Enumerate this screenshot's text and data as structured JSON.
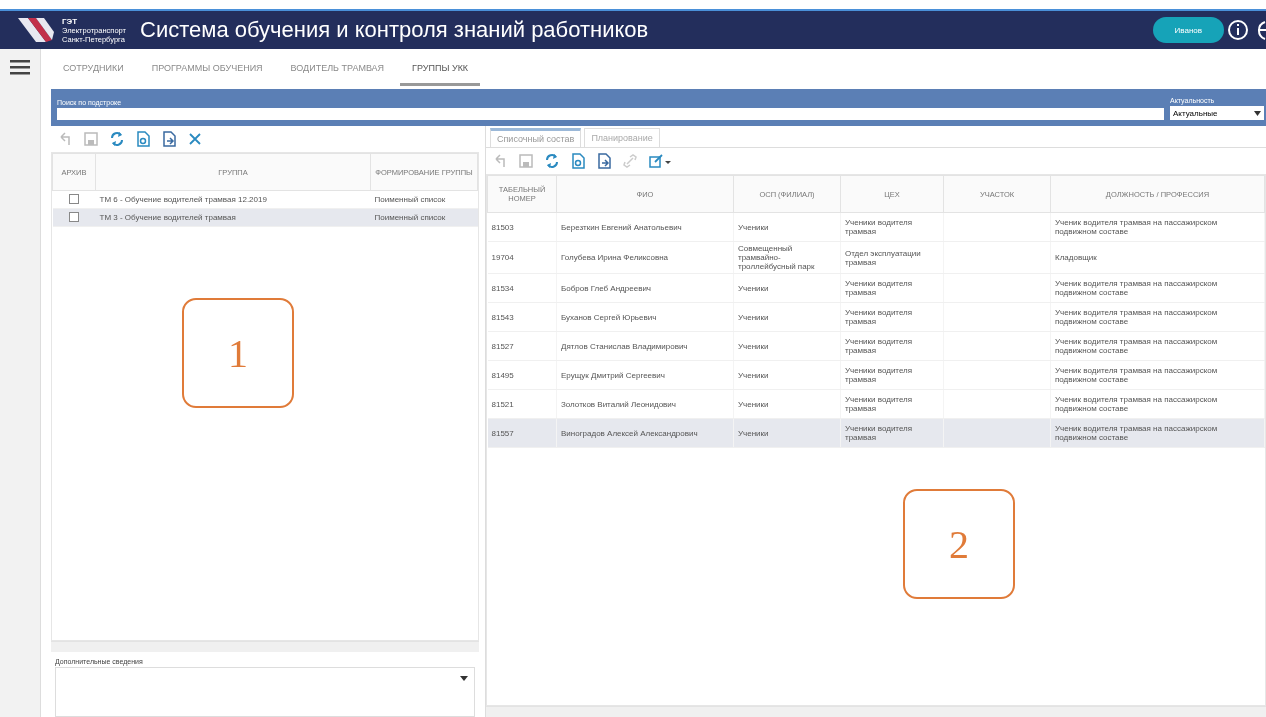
{
  "header": {
    "logo_lines": [
      "ГЭТ",
      "Электротранспорт",
      "Санкт-Петербурга"
    ],
    "title": "Система обучения и контроля знаний работников",
    "user_button": "Иванов"
  },
  "nav_tabs": [
    {
      "label": "СОТРУДНИКИ",
      "selected": false
    },
    {
      "label": "ПРОГРАММЫ ОБУЧЕНИЯ",
      "selected": false
    },
    {
      "label": "ВОДИТЕЛЬ ТРАМВАЯ",
      "selected": false
    },
    {
      "label": "ГРУППЫ УКК",
      "selected": true
    }
  ],
  "search": {
    "label": "Поиск по подстроке",
    "relevance_label": "Актуальность",
    "relevance_value": "Актуальные"
  },
  "groups_table": {
    "columns": [
      "АРХИВ",
      "ГРУППА",
      "ФОРМИРОВАНИЕ ГРУППЫ"
    ],
    "rows": [
      {
        "archived": false,
        "group": "ТМ 6 - Обучение водителей трамвая 12.2019",
        "formation": "Поименный список",
        "selected": false
      },
      {
        "archived": false,
        "group": "ТМ 3 - Обучение водителей трамвая",
        "formation": "Поименный список",
        "selected": true
      }
    ]
  },
  "additional_info": {
    "label": "Дополнительные сведения"
  },
  "detail_tabs": [
    {
      "label": "Списочный состав",
      "selected": true
    },
    {
      "label": "Планирование",
      "selected": false
    }
  ],
  "staff_table": {
    "columns": [
      "ТАБЕЛЬНЫЙ НОМЕР",
      "ФИО",
      "ОСП (ФИЛИАЛ)",
      "ЦЕХ",
      "УЧАСТОК",
      "ДОЛЖНОСТЬ / ПРОФЕССИЯ"
    ],
    "rows": [
      {
        "cells": [
          "81503",
          "Березткин Евгений Анатольевич",
          "Ученики",
          "Ученики водителя трамвая",
          "",
          "Ученик водителя трамвая на пассажирском подвижном составе"
        ],
        "selected": false
      },
      {
        "cells": [
          "19704",
          "Голубева Ирина Феликсовна",
          "Совмещенный трамвайно-троллейбусный парк",
          "Отдел эксплуатации трамвая",
          "",
          "Кладовщик"
        ],
        "selected": false
      },
      {
        "cells": [
          "81534",
          "Бобров Глеб Андреевич",
          "Ученики",
          "Ученики водителя трамвая",
          "",
          "Ученик водителя трамвая на пассажирском подвижном составе"
        ],
        "selected": false
      },
      {
        "cells": [
          "81543",
          "Буханов Сергей Юрьевич",
          "Ученики",
          "Ученики водителя трамвая",
          "",
          "Ученик водителя трамвая на пассажирском подвижном составе"
        ],
        "selected": false
      },
      {
        "cells": [
          "81527",
          "Дятлов Станислав Владимирович",
          "Ученики",
          "Ученики водителя трамвая",
          "",
          "Ученик водителя трамвая на пассажирском подвижном составе"
        ],
        "selected": false
      },
      {
        "cells": [
          "81495",
          "Ерущук Дмитрий Сергеевич",
          "Ученики",
          "Ученики водителя трамвая",
          "",
          "Ученик водителя трамвая на пассажирском подвижном составе"
        ],
        "selected": false
      },
      {
        "cells": [
          "81521",
          "Золотков Виталий Леонидович",
          "Ученики",
          "Ученики водителя трамвая",
          "",
          "Ученик водителя трамвая на пассажирском подвижном составе"
        ],
        "selected": false
      },
      {
        "cells": [
          "81557",
          "Виноградов Алексей Александрович",
          "Ученики",
          "Ученики водителя трамвая",
          "",
          "Ученик водителя трамвая на пассажирском подвижном составе"
        ],
        "selected": true
      }
    ]
  },
  "callouts": [
    "1",
    "2"
  ]
}
